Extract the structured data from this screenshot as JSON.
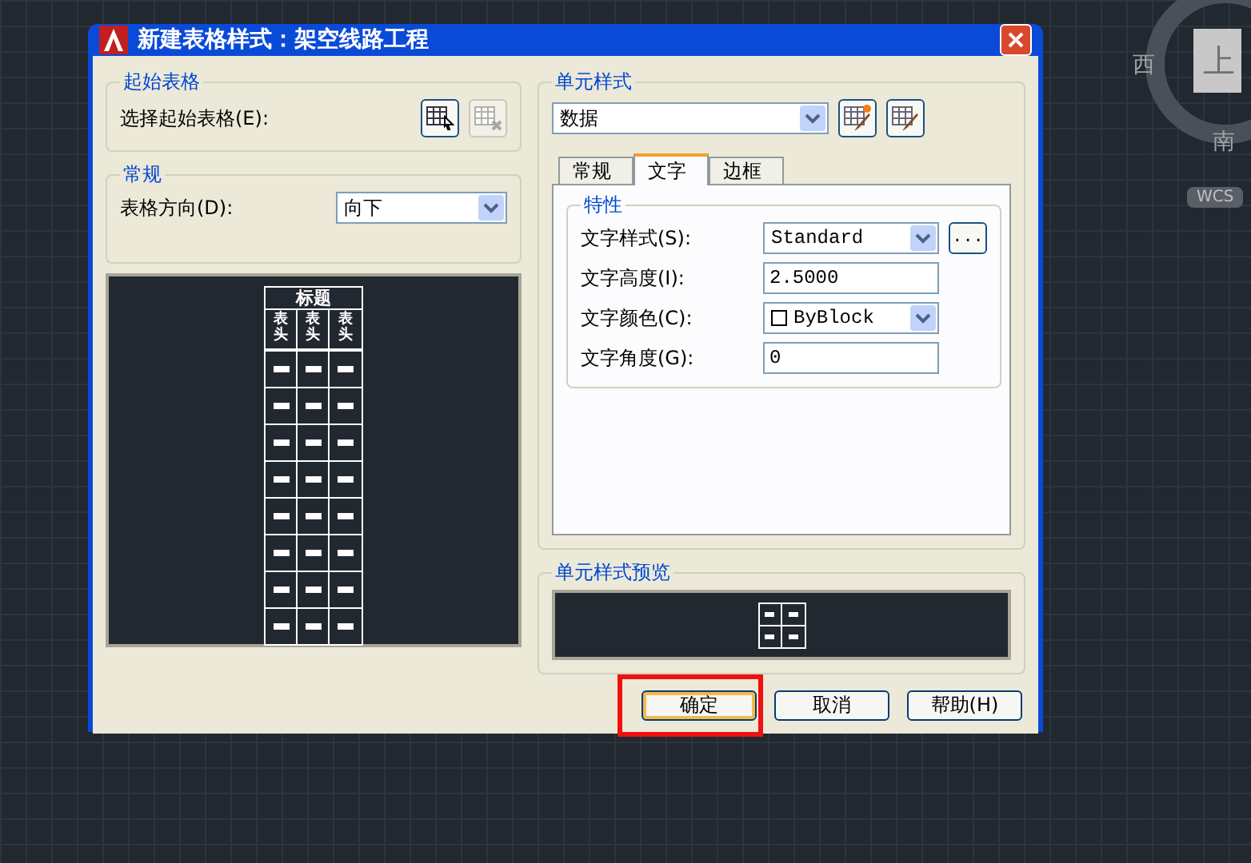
{
  "viewcube": {
    "west": "西",
    "top": "上",
    "south": "南",
    "wcs": "WCS"
  },
  "dialog": {
    "title": "新建表格样式：架空线路工程",
    "starting_table": {
      "legend": "起始表格",
      "label": "选择起始表格(E):",
      "buttons": [
        {
          "kind": "select",
          "disabled": false
        },
        {
          "kind": "remove",
          "disabled": true
        }
      ]
    },
    "general": {
      "legend": "常规",
      "label": "表格方向(D):",
      "value": "向下"
    },
    "table_preview": {
      "title": "标题",
      "headers": [
        "表头",
        "表头",
        "表头"
      ]
    },
    "cell_styles": {
      "legend": "单元样式",
      "value": "数据",
      "tabs": [
        {
          "label": "常规",
          "selected": false
        },
        {
          "label": "文字",
          "selected": true
        },
        {
          "label": "边框",
          "selected": false
        }
      ],
      "properties": {
        "legend": "特性",
        "rows": [
          {
            "kind": "select",
            "label": "文字样式(S):",
            "value": "Standard",
            "browse": "..."
          },
          {
            "kind": "input",
            "label": "文字高度(I):",
            "value": "2.5000"
          },
          {
            "kind": "color-select",
            "label": "文字颜色(C):",
            "value": "ByBlock"
          },
          {
            "kind": "input",
            "label": "文字角度(G):",
            "value": "0"
          }
        ]
      }
    },
    "cell_preview": {
      "legend": "单元样式预览"
    },
    "buttons": [
      {
        "label": "确定",
        "default": true,
        "highlighted": true
      },
      {
        "label": "取消",
        "default": false,
        "highlighted": false
      },
      {
        "label": "帮助(H)",
        "default": false,
        "highlighted": false
      }
    ]
  }
}
